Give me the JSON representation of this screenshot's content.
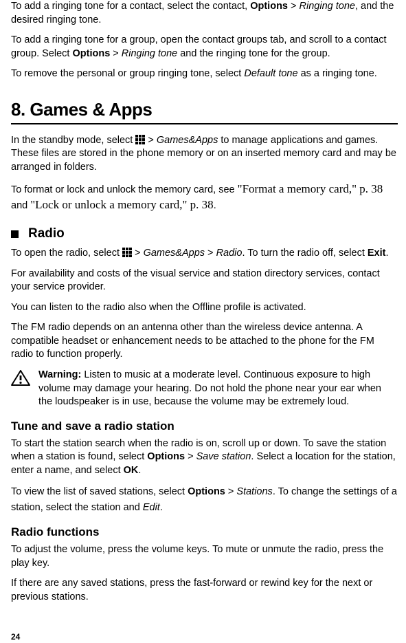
{
  "page": {
    "number": "24"
  },
  "intro": {
    "p1_a": "To add a ringing tone for a contact, select the contact, ",
    "p1_b": "Options",
    "p1_c": " > ",
    "p1_d": "Ringing tone",
    "p1_e": ", and the desired ringing tone.",
    "p2_a": "To add a ringing tone for a group, open the contact groups tab, and scroll to a contact group. Select ",
    "p2_b": "Options",
    "p2_c": " > ",
    "p2_d": "Ringing tone",
    "p2_e": " and the ringing tone for the group.",
    "p3_a": "To remove the personal or group ringing tone, select ",
    "p3_b": "Default tone",
    "p3_c": " as a ringing tone."
  },
  "chapter": {
    "title": "8.   Games & Apps",
    "p1_a": "In the standby mode, select ",
    "p1_b": " > ",
    "p1_c": "Games&Apps",
    "p1_d": " to manage applications and games. These files are stored in the phone memory or on an inserted memory card and may be arranged in folders.",
    "p2_a": "To format or lock and unlock the memory card, see ",
    "p2_b": "\"Format a memory card,\" p. 38",
    "p2_c": " and ",
    "p2_d": "\"Lock or unlock a memory card,\" p. 38",
    "p2_e": "."
  },
  "radio": {
    "title": "Radio",
    "p1_a": "To open the radio, select ",
    "p1_b": " > ",
    "p1_c": "Games&Apps",
    "p1_d": " > ",
    "p1_e": "Radio",
    "p1_f": ". To turn the radio off, select ",
    "p1_g": "Exit",
    "p1_h": ".",
    "p2": "For availability and costs of the visual service and station directory services, contact your service provider.",
    "p3": "You can listen to the radio also when the Offline profile is activated.",
    "p4": "The FM radio depends on an antenna other than the wireless device antenna. A compatible headset or enhancement needs to be attached to the phone for the FM radio to function properly.",
    "warn_a": "Warning:",
    "warn_b": " Listen to music at a moderate level. Continuous exposure to high volume may damage your hearing. Do not hold the phone near your ear when the loudspeaker is in use, because the volume may be extremely loud."
  },
  "tune": {
    "title": "Tune and save a radio station",
    "p1_a": "To start the station search when the radio is on, scroll up or down. To save the station when a station is found, select ",
    "p1_b": "Options",
    "p1_c": " > ",
    "p1_d": "Save station",
    "p1_e": ". Select a location for the station, enter a name, and select ",
    "p1_f": "OK",
    "p1_g": ".",
    "p2_a": "To view the list of saved stations, select ",
    "p2_b": "Options",
    "p2_c": " > ",
    "p2_d": "Stations",
    "p2_e": ". To change the settings of a station, select the station and ",
    "p2_f": "Edit",
    "p2_g": "."
  },
  "functions": {
    "title": "Radio functions",
    "p1": "To adjust the volume, press the volume keys. To mute or unmute the radio, press the play key.",
    "p2": "If there are any saved stations, press the fast-forward or rewind key for the next or previous stations."
  }
}
